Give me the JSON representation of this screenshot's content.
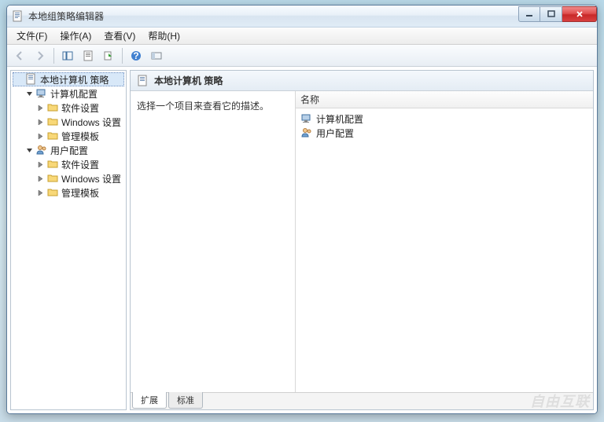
{
  "window": {
    "title": "本地组策略编辑器"
  },
  "menubar": [
    "文件(F)",
    "操作(A)",
    "查看(V)",
    "帮助(H)"
  ],
  "tree": {
    "root": {
      "label": "本地计算机 策略"
    },
    "nodes": [
      {
        "label": "计算机配置",
        "children": [
          "软件设置",
          "Windows 设置",
          "管理模板"
        ]
      },
      {
        "label": "用户配置",
        "children": [
          "软件设置",
          "Windows 设置",
          "管理模板"
        ]
      }
    ]
  },
  "rightPane": {
    "title": "本地计算机 策略",
    "description": "选择一个项目来查看它的描述。",
    "columnHeader": "名称",
    "items": [
      "计算机配置",
      "用户配置"
    ]
  },
  "tabs": {
    "extended": "扩展",
    "standard": "标准"
  },
  "watermark": "自由互联"
}
